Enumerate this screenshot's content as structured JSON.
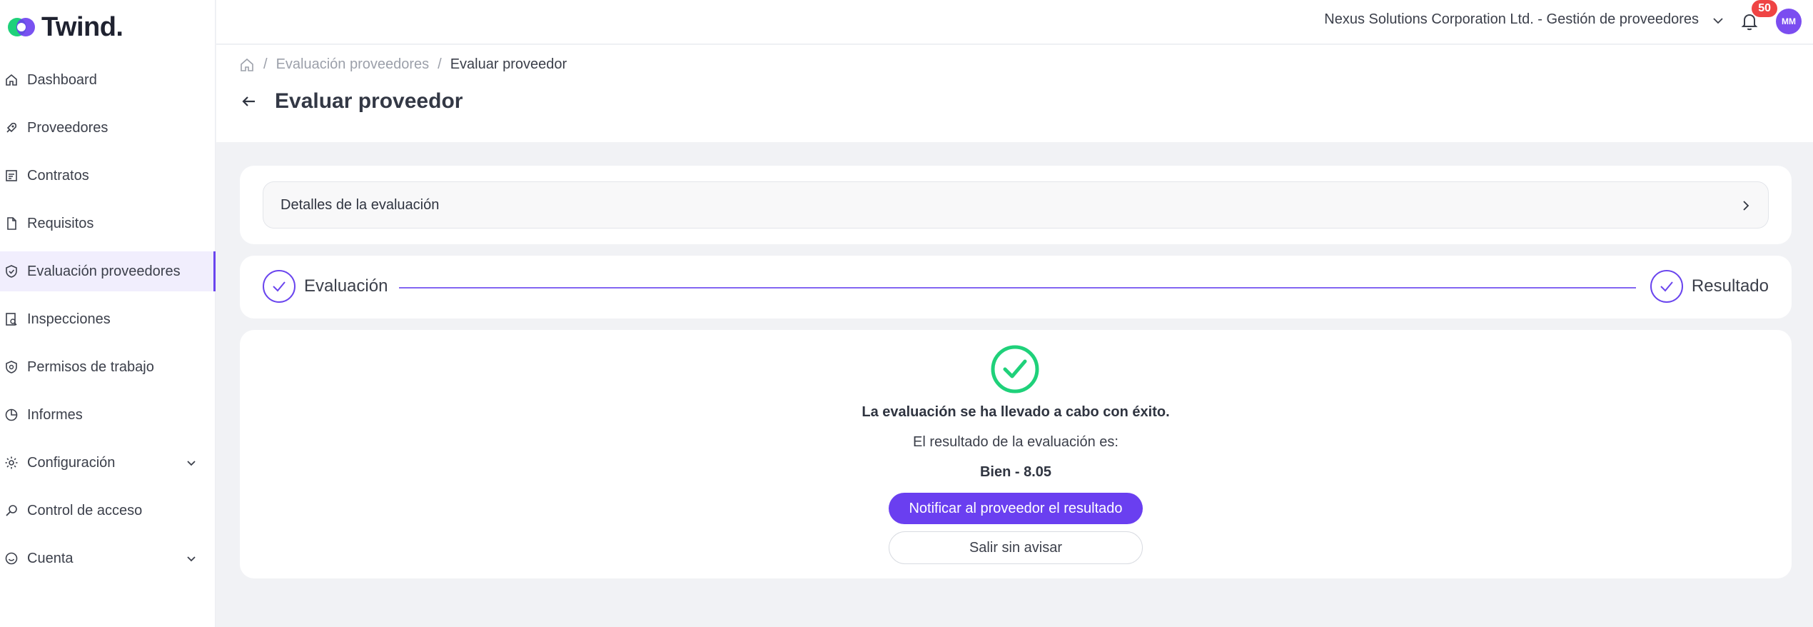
{
  "app": {
    "logo_text": "Twind."
  },
  "sidebar": {
    "items": [
      {
        "label": "Dashboard",
        "icon": "home-icon"
      },
      {
        "label": "Proveedores",
        "icon": "rocket-icon"
      },
      {
        "label": "Contratos",
        "icon": "contract-icon"
      },
      {
        "label": "Requisitos",
        "icon": "document-icon"
      },
      {
        "label": "Evaluación proveedores",
        "icon": "shield-check-icon",
        "active": true
      },
      {
        "label": "Inspecciones",
        "icon": "inspection-icon"
      },
      {
        "label": "Permisos de trabajo",
        "icon": "shield-icon"
      },
      {
        "label": "Informes",
        "icon": "pie-chart-icon"
      },
      {
        "label": "Configuración",
        "icon": "gear-icon",
        "expandable": true
      },
      {
        "label": "Control de acceso",
        "icon": "key-icon"
      },
      {
        "label": "Cuenta",
        "icon": "user-circle-icon",
        "expandable": true
      }
    ]
  },
  "topbar": {
    "company": "Nexus Solutions Corporation Ltd. - Gestión de proveedores",
    "notifications_count": "50",
    "avatar_initials": "MM"
  },
  "breadcrumb": {
    "items": [
      "Evaluación proveedores"
    ],
    "current": "Evaluar proveedor"
  },
  "page": {
    "title": "Evaluar proveedor"
  },
  "details": {
    "label": "Detalles de la evaluación"
  },
  "steps": [
    {
      "label": "Evaluación",
      "completed": true
    },
    {
      "label": "Resultado",
      "completed": true
    }
  ],
  "result": {
    "message": "La evaluación se ha llevado a cabo con éxito.",
    "label": "El resultado de la evaluación es:",
    "value": "Bien - 8.05",
    "primary_button": "Notificar al proveedor el resultado",
    "secondary_button": "Salir sin avisar"
  },
  "colors": {
    "accent": "#6a3ff0",
    "success": "#1fd17a",
    "badge": "#ef4444"
  }
}
